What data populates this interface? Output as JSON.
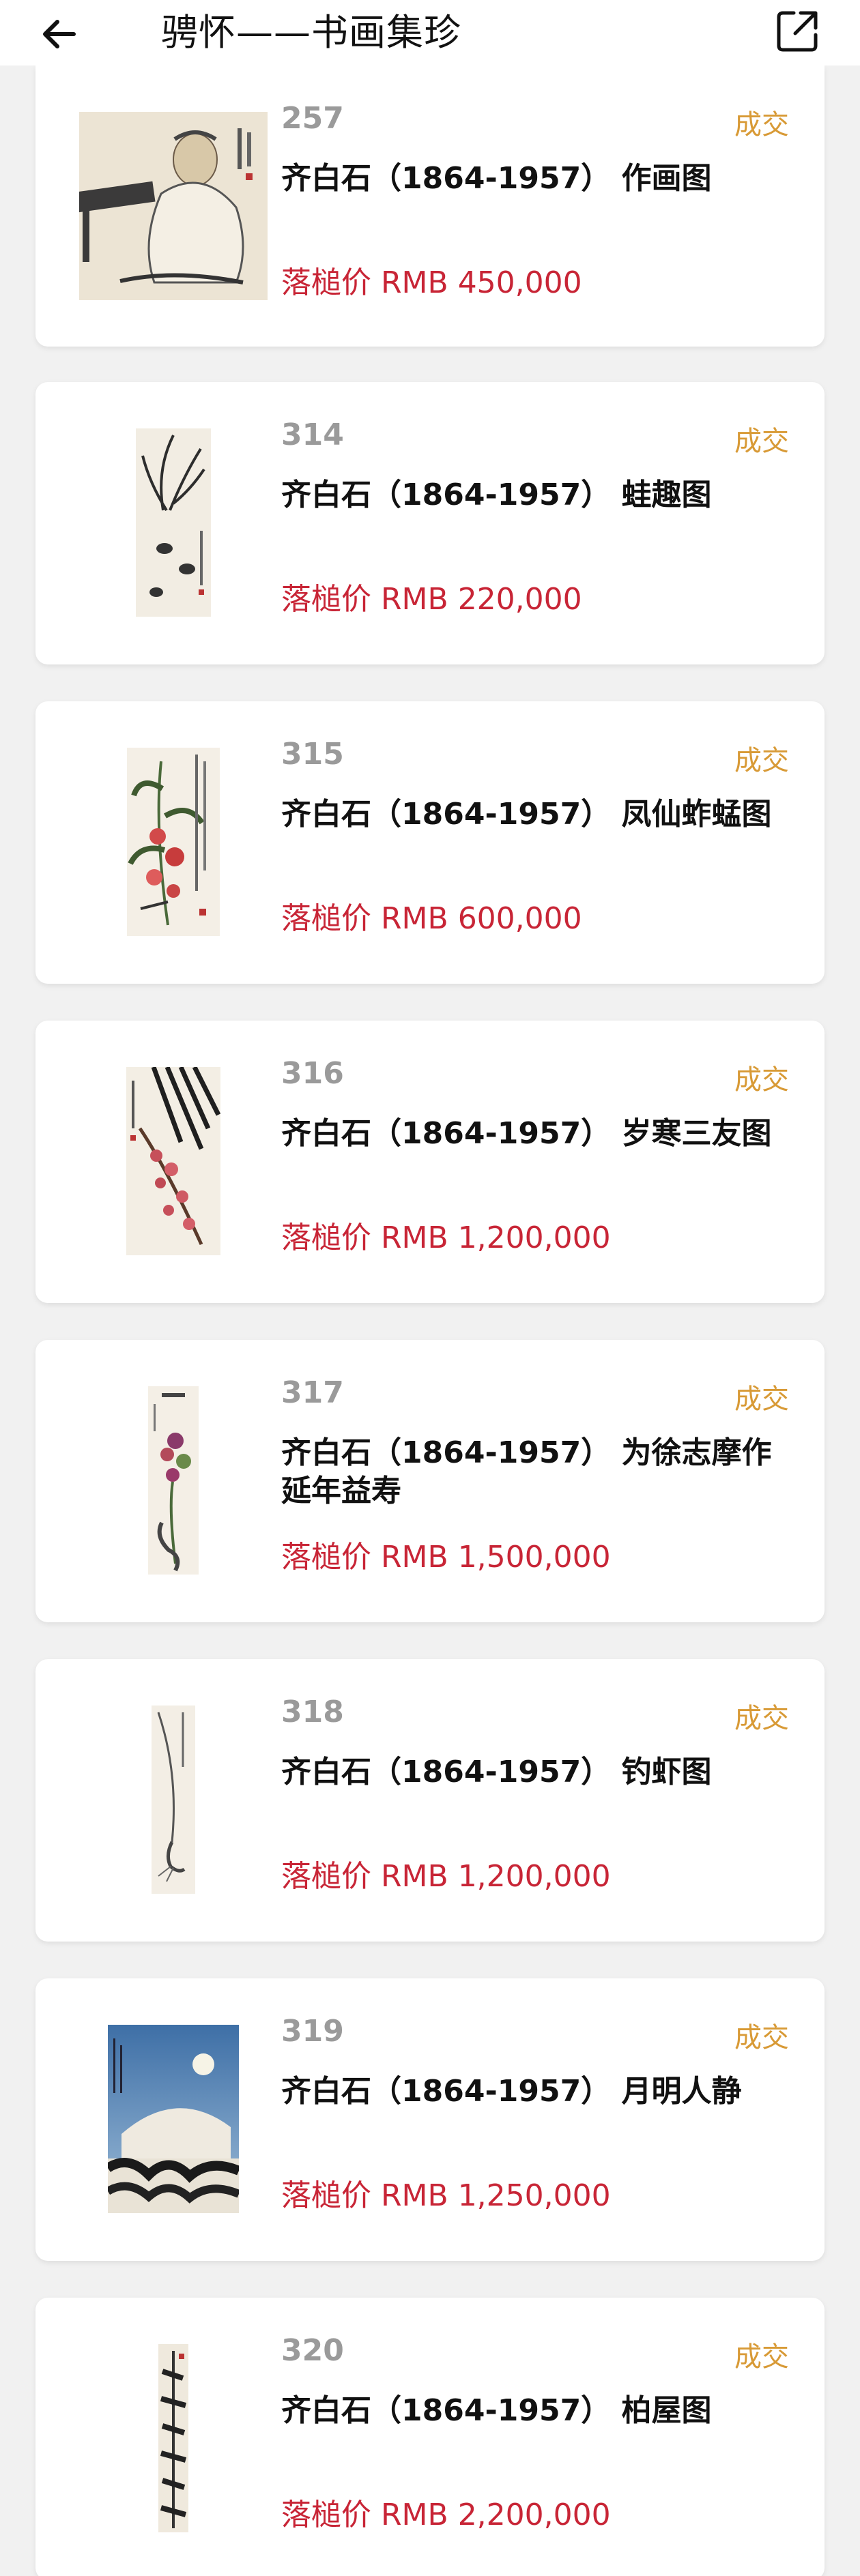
{
  "header": {
    "title": "骋怀——书画集珍",
    "back_icon": "arrow-left-icon",
    "share_icon": "share-icon"
  },
  "colors": {
    "status": "#d89a36",
    "price": "#c82536",
    "lot": "#9a9a9a"
  },
  "lots": [
    {
      "lot": "257",
      "status": "成交",
      "title": "齐白石（1864-1957） 作画图",
      "price": "落槌价 RMB 450,000",
      "thumb": "painting-figure-thumb"
    },
    {
      "lot": "314",
      "status": "成交",
      "title": "齐白石（1864-1957） 蛙趣图",
      "price": "落槌价 RMB 220,000",
      "thumb": "painting-frogs-thumb"
    },
    {
      "lot": "315",
      "status": "成交",
      "title": "齐白石（1864-1957） 凤仙蚱蜢图",
      "price": "落槌价 RMB 600,000",
      "thumb": "painting-balsam-thumb"
    },
    {
      "lot": "316",
      "status": "成交",
      "title": "齐白石（1864-1957） 岁寒三友图",
      "price": "落槌价 RMB 1,200,000",
      "thumb": "painting-three-friends-thumb"
    },
    {
      "lot": "317",
      "status": "成交",
      "title": "齐白石（1864-1957） 为徐志摩作延年益寿",
      "price": "落槌价 RMB 1,500,000",
      "thumb": "painting-chrysanthemum-thumb"
    },
    {
      "lot": "318",
      "status": "成交",
      "title": "齐白石（1864-1957） 钓虾图",
      "price": "落槌价 RMB 1,200,000",
      "thumb": "painting-shrimp-thumb"
    },
    {
      "lot": "319",
      "status": "成交",
      "title": "齐白石（1864-1957） 月明人静",
      "price": "落槌价 RMB 1,250,000",
      "thumb": "painting-moon-thumb"
    },
    {
      "lot": "320",
      "status": "成交",
      "title": "齐白石（1864-1957） 柏屋图",
      "price": "落槌价 RMB 2,200,000",
      "thumb": "painting-cypress-thumb"
    }
  ]
}
